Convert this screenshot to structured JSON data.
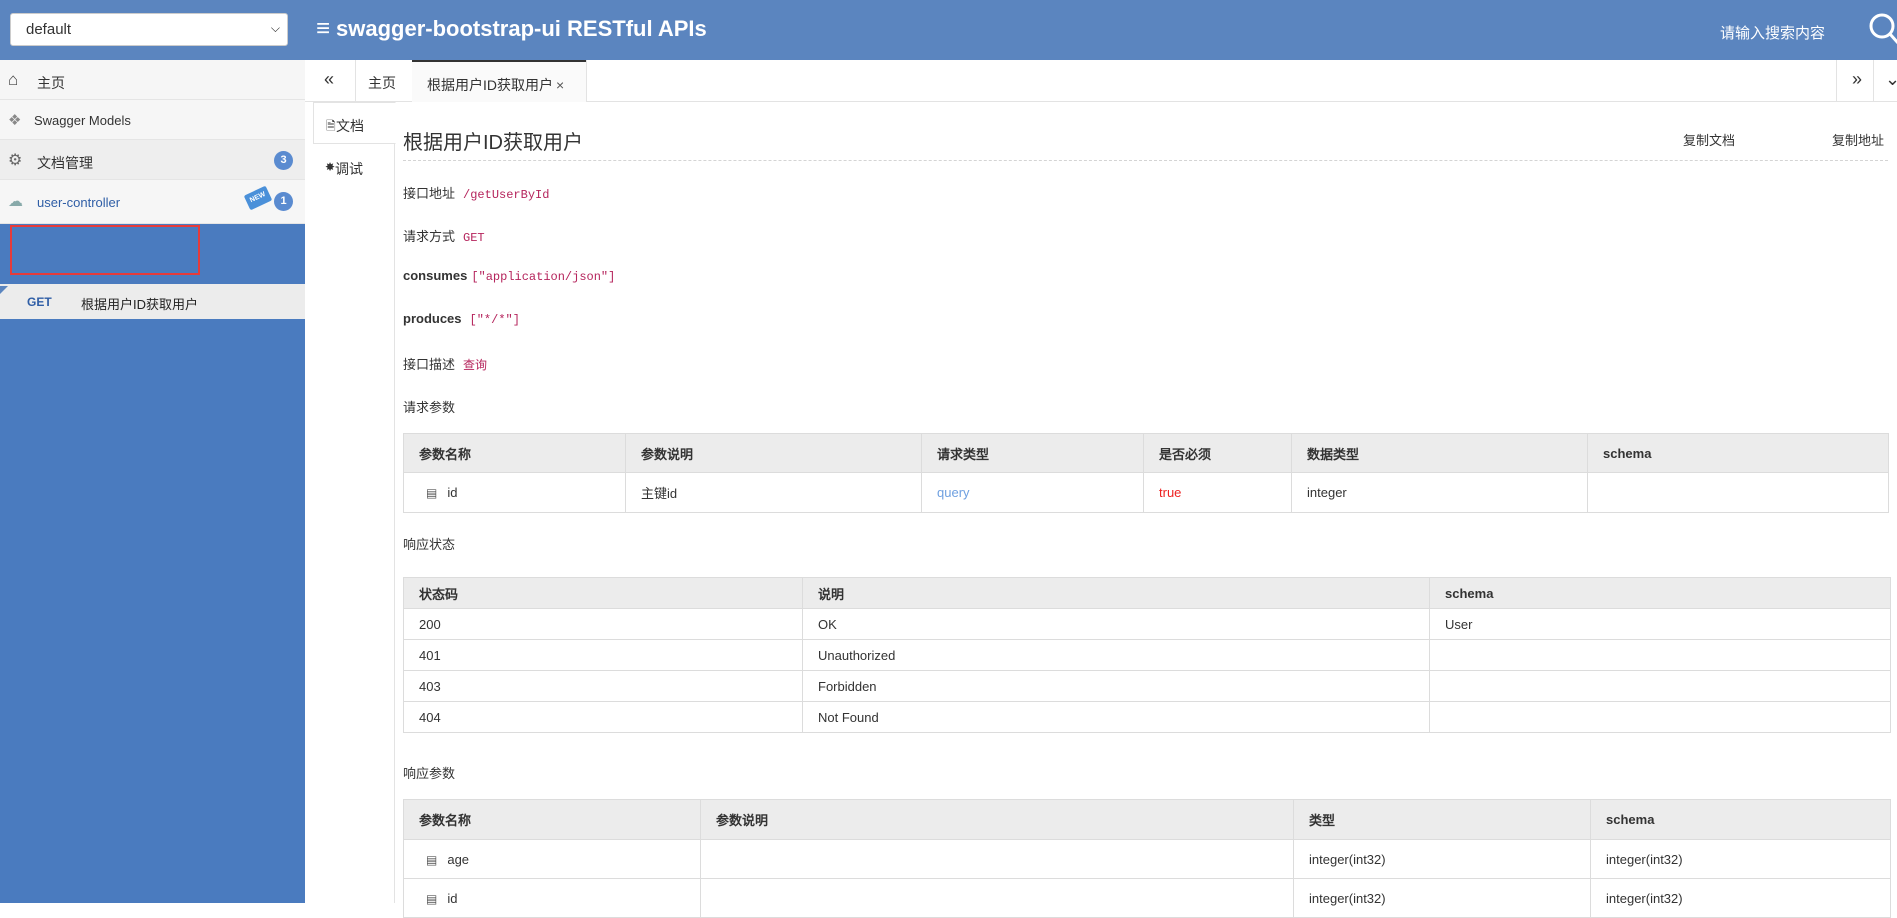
{
  "header": {
    "group_select": "default",
    "title": "swagger-bootstrap-ui RESTful APIs",
    "search_placeholder": "请输入搜索内容",
    "colors": {
      "header_bg": "#5b85bf",
      "sidebar_bg": "#4a7bbf"
    }
  },
  "sidebar": {
    "home": "主页",
    "models": "Swagger Models",
    "doc_manage": {
      "label": "文档管理",
      "count": "3"
    },
    "controller": {
      "label": "user-controller",
      "new_tag": "NEW",
      "count": "1"
    },
    "api": {
      "method": "GET",
      "name": "根据用户ID获取用户"
    }
  },
  "tabs": {
    "items": [
      "主页",
      "根据用户ID获取用户"
    ],
    "close": "×",
    "prev": "«",
    "next": "»"
  },
  "subtabs": {
    "doc": "文档",
    "debug": "调试"
  },
  "doc": {
    "title": "根据用户ID获取用户",
    "copy_doc": "复制文档",
    "copy_url": "复制地址",
    "fields": {
      "url_label": "接口地址",
      "url": "/getUserById",
      "method_label": "请求方式",
      "method": "GET",
      "consumes_label": "consumes",
      "consumes": "[\"application/json\"]",
      "produces_label": "produces",
      "produces": "[\"*/*\"]",
      "desc_label": "接口描述",
      "desc": "查询"
    },
    "req_params_title": "请求参数",
    "req_params": {
      "headers": [
        "参数名称",
        "参数说明",
        "请求类型",
        "是否必须",
        "数据类型",
        "schema"
      ],
      "rows": [
        {
          "name": "id",
          "desc": "主键id",
          "in": "query",
          "required": "true",
          "type": "integer",
          "schema": ""
        }
      ]
    },
    "resp_status_title": "响应状态",
    "resp_status": {
      "headers": [
        "状态码",
        "说明",
        "schema"
      ],
      "rows": [
        {
          "code": "200",
          "desc": "OK",
          "schema": "User"
        },
        {
          "code": "401",
          "desc": "Unauthorized",
          "schema": ""
        },
        {
          "code": "403",
          "desc": "Forbidden",
          "schema": ""
        },
        {
          "code": "404",
          "desc": "Not Found",
          "schema": ""
        }
      ]
    },
    "resp_params_title": "响应参数",
    "resp_params": {
      "headers": [
        "参数名称",
        "参数说明",
        "类型",
        "schema"
      ],
      "rows": [
        {
          "name": "age",
          "desc": "",
          "type": "integer(int32)",
          "schema": "integer(int32)"
        },
        {
          "name": "id",
          "desc": "",
          "type": "integer(int32)",
          "schema": "integer(int32)"
        }
      ]
    }
  }
}
